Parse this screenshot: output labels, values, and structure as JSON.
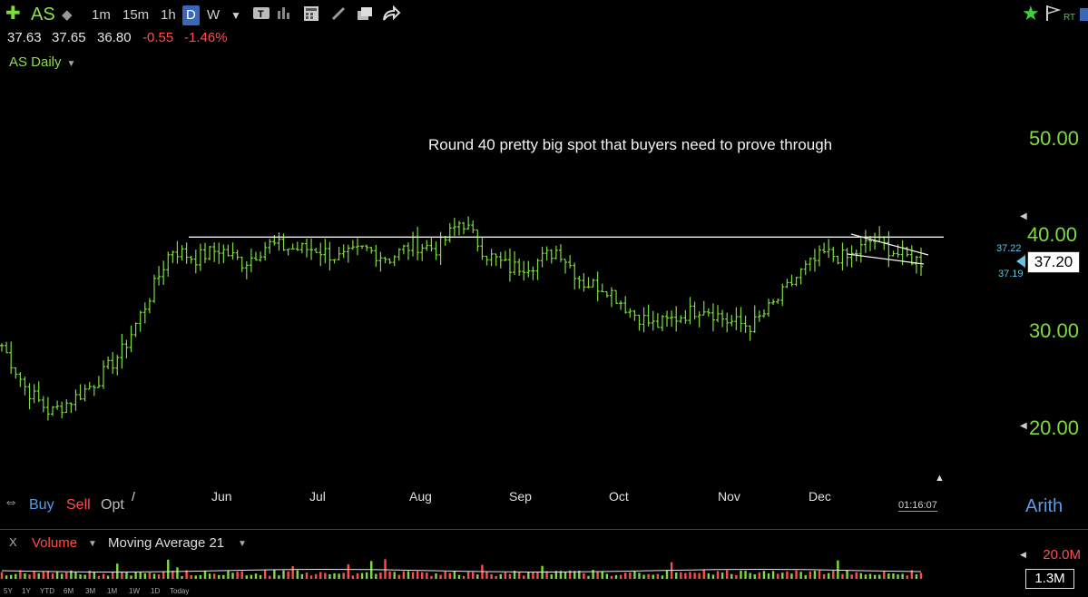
{
  "toolbar": {
    "ticker": "AS",
    "intervals": [
      "1m",
      "15m",
      "1h",
      "D",
      "W"
    ],
    "active_interval": "D",
    "right_labels": {
      "rt": "RT"
    }
  },
  "quote": {
    "open": "37.63",
    "high": "37.65",
    "low": "36.80",
    "change": "-0.55",
    "change_pct": "-1.46%"
  },
  "chart_title": "AS Daily",
  "annotation": "Round 40 pretty big spot that buyers need to prove through",
  "y_axis_ticks": [
    "50.00",
    "40.00",
    "30.00",
    "20.00"
  ],
  "last_price": "37.20",
  "bid": "37.22",
  "ask": "37.19",
  "x_months": [
    "Jun",
    "Jul",
    "Aug",
    "Sep",
    "Oct",
    "Nov",
    "Dec"
  ],
  "trade_buttons": {
    "buy": "Buy",
    "sell": "Sell",
    "opt": "Opt"
  },
  "scale_mode": "Arith",
  "clock": "01:16:07",
  "volume_panel": {
    "close": "X",
    "indicator": "Volume",
    "overlay": "Moving Average 21",
    "axis_max": "20.0M",
    "current": "1.3M"
  },
  "ranges": [
    "5Y",
    "1Y",
    "YTD",
    "6M",
    "3M",
    "1M",
    "1W",
    "1D",
    "Today"
  ],
  "colors": {
    "up": "#7ddc3c",
    "down": "#ff4d4d",
    "accent": "#5a9ce8",
    "background": "#000000"
  },
  "chart_data": {
    "type": "ohlc",
    "ylim": [
      20,
      50
    ],
    "resistance_level": 40,
    "approx_closes": [
      28.5,
      24,
      21.5,
      23,
      25,
      28,
      33,
      38.5,
      37.5,
      38.5,
      37,
      39,
      38.5,
      38.5,
      37.5,
      38.5,
      37.5,
      39,
      38.5,
      41.5,
      38,
      36.5,
      37,
      38.5,
      35,
      34.5,
      32,
      30.5,
      31.5,
      32.5,
      31,
      30.5,
      33,
      36,
      38,
      37.5,
      39.5,
      38,
      37.2
    ]
  }
}
